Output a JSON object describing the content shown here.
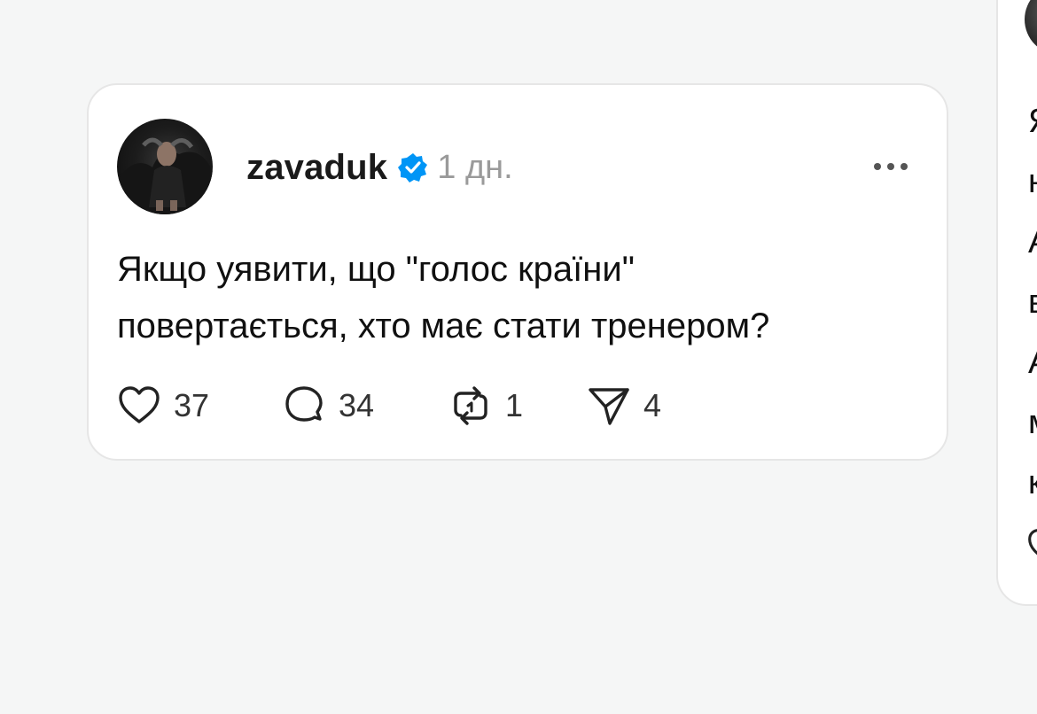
{
  "post": {
    "username": "zavaduk",
    "verified": true,
    "time": "1 дн.",
    "text_lines": [
      "Якщо уявити, що \"голос країни\"",
      "повертається, хто має стати тренером?"
    ],
    "actions": {
      "likes": "37",
      "replies": "34",
      "reposts": "1",
      "shares": "4"
    },
    "icons": {
      "like": "heart-icon",
      "reply": "comment-icon",
      "repost": "repost-icon",
      "share": "send-icon",
      "more": "more-icon",
      "verified": "verified-badge-icon"
    }
  },
  "side_post": {
    "text_line_starts": [
      "Я",
      "н",
      "А",
      "в",
      "А",
      "м",
      "к"
    ]
  },
  "colors": {
    "background": "#f5f6f6",
    "card": "#ffffff",
    "verified_blue": "#0095f6",
    "muted_text": "#9a9a9a"
  }
}
